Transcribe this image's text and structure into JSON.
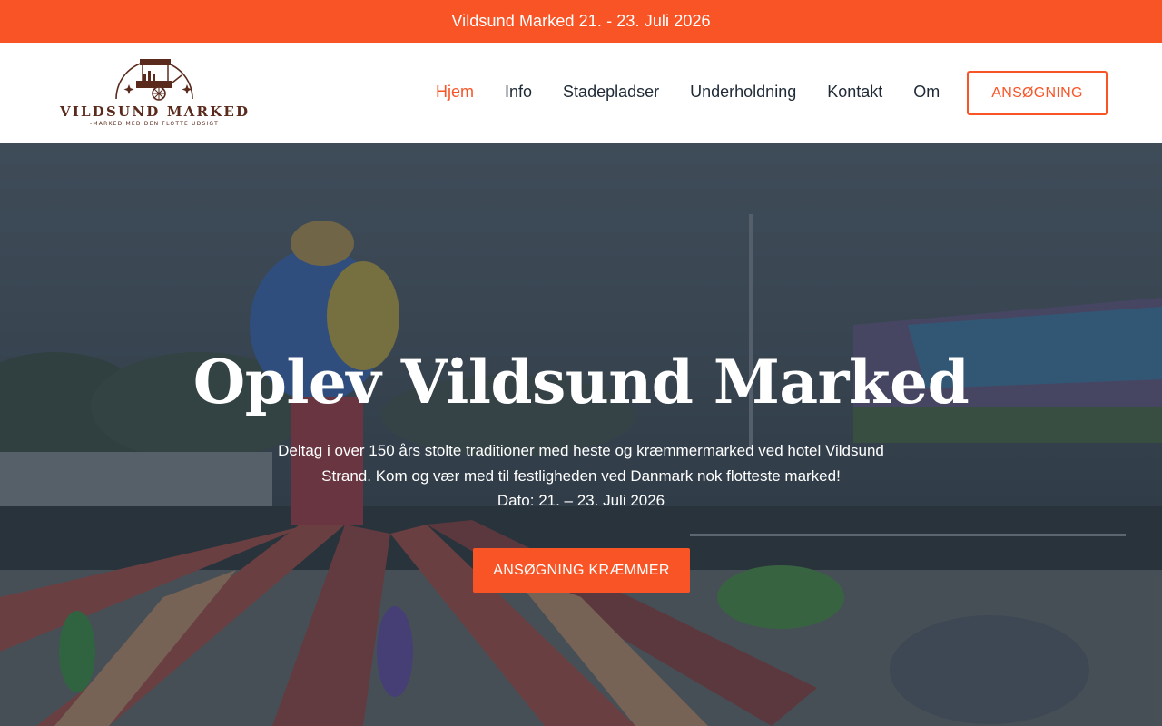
{
  "announcement": "Vildsund Marked 21. - 23. Juli 2026",
  "logo": {
    "name": "VILDSUND MARKED",
    "tagline": "-MARKED MED DEN FLOTTE UDSIGT"
  },
  "nav": [
    {
      "label": "Hjem",
      "active": true
    },
    {
      "label": "Info",
      "active": false
    },
    {
      "label": "Stadepladser",
      "active": false
    },
    {
      "label": "Underholdning",
      "active": false
    },
    {
      "label": "Kontakt",
      "active": false
    },
    {
      "label": "Om",
      "active": false
    }
  ],
  "header_cta": "ANSØGNING",
  "hero": {
    "title": "Oplev Vildsund Marked",
    "line1": "Deltag i over 150 års stolte traditioner med heste og kræmmermarked ved hotel Vildsund",
    "line2": "Strand. Kom og vær med til festligheden ved Danmark nok flotteste marked!",
    "line3": "Dato: 21. – 23. Juli 2026",
    "button": "ANSØGNING KRÆMMER"
  },
  "colors": {
    "accent": "#f95426",
    "text_dark": "#1f2a36",
    "logo_brown": "#5a2a1c"
  }
}
